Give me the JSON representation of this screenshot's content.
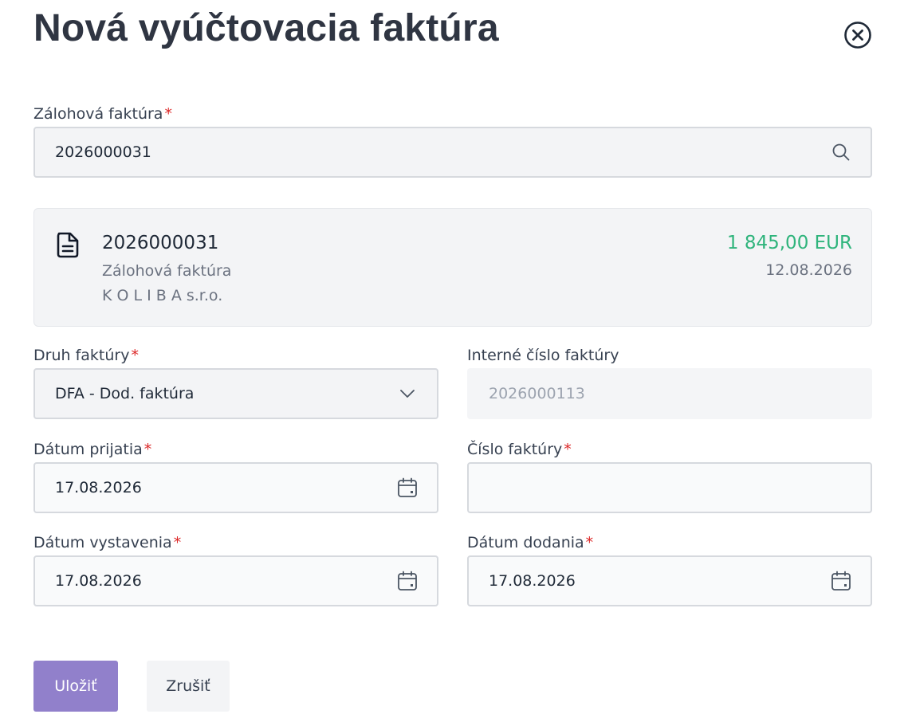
{
  "dialog": {
    "title": "Nová vyúčtovacia faktúra",
    "close_icon": "close-circle-icon"
  },
  "advance_invoice": {
    "label": "Zálohová faktúra",
    "required_mark": "*",
    "value": "2026000031",
    "icon": "search-icon"
  },
  "selected_invoice": {
    "icon": "document-icon",
    "number": "2026000031",
    "type": "Zálohová faktúra",
    "company": "K O L I B A s.r.o.",
    "amount": "1 845,00 EUR",
    "date": "12.08.2026",
    "amount_color": "#2fb47c"
  },
  "invoice_type": {
    "label": "Druh faktúry",
    "required_mark": "*",
    "value": "DFA - Dod. faktúra",
    "icon": "chevron-down-icon"
  },
  "internal_number": {
    "label": "Interné číslo faktúry",
    "value": "2026000113"
  },
  "received_date": {
    "label": "Dátum prijatia",
    "required_mark": "*",
    "value": "17.08.2026",
    "icon": "calendar-icon"
  },
  "invoice_number": {
    "label": "Číslo faktúry",
    "required_mark": "*",
    "value": ""
  },
  "issue_date": {
    "label": "Dátum vystavenia",
    "required_mark": "*",
    "value": "17.08.2026",
    "icon": "calendar-icon"
  },
  "delivery_date": {
    "label": "Dátum dodania",
    "required_mark": "*",
    "value": "17.08.2026",
    "icon": "calendar-icon"
  },
  "actions": {
    "save_label": "Uložiť",
    "cancel_label": "Zrušiť",
    "primary_color": "#9180cb"
  }
}
